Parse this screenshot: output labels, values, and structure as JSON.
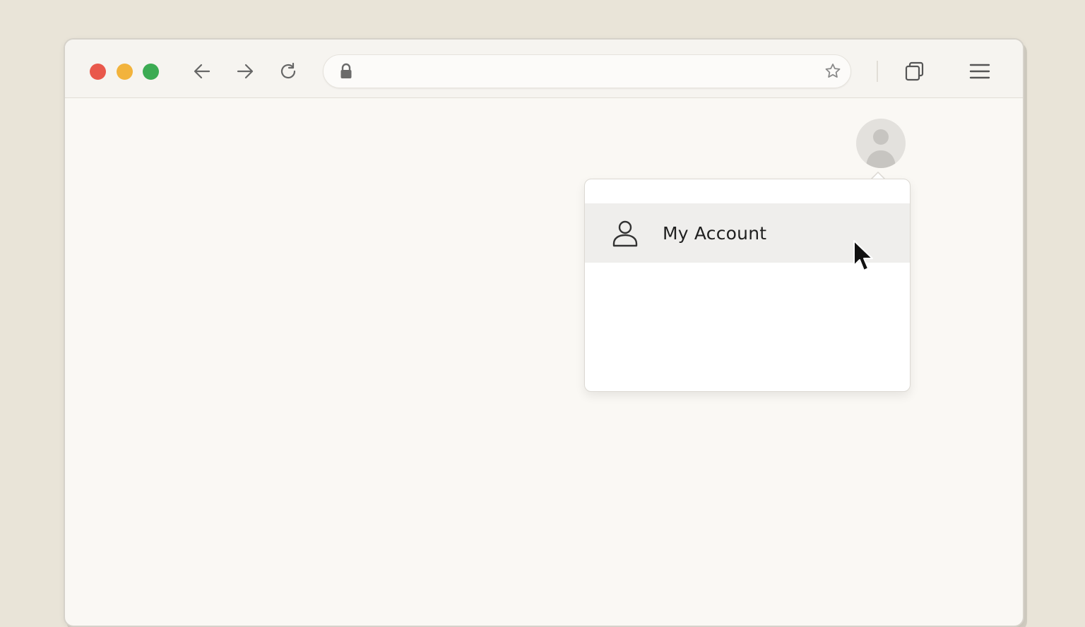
{
  "window": {
    "traffic_lights": {
      "close_color": "#e9584b",
      "minimize_color": "#f2b33c",
      "maximize_color": "#3cab53"
    }
  },
  "toolbar": {
    "back_icon": "arrow-left-icon",
    "forward_icon": "arrow-right-icon",
    "reload_icon": "reload-icon",
    "tabs_icon": "tabs-icon",
    "menu_icon": "hamburger-menu-icon"
  },
  "address_bar": {
    "value": "",
    "lock_icon": "lock-icon",
    "bookmark_icon": "star-icon"
  },
  "profile": {
    "avatar_icon": "user-avatar-icon"
  },
  "dropdown": {
    "items": [
      {
        "label": "My Account",
        "icon": "user-icon",
        "hovered": true
      }
    ]
  }
}
